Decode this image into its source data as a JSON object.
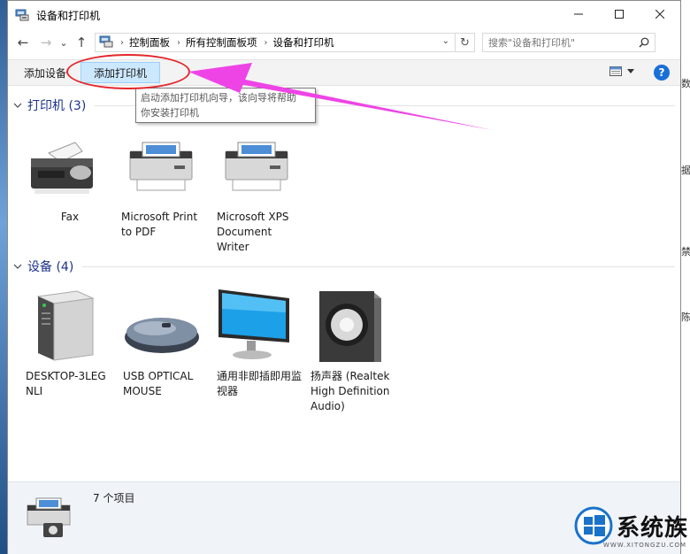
{
  "window": {
    "title": "设备和打印机"
  },
  "nav": {
    "breadcrumbs": [
      "控制面板",
      "所有控制面板项",
      "设备和打印机"
    ],
    "search_placeholder": "搜索\"设备和打印机\""
  },
  "toolbar": {
    "add_device": "添加设备",
    "add_printer": "添加打印机",
    "help": "?"
  },
  "tooltip": {
    "line1": "启动添加打印机向导，该向导将帮助",
    "line2": "你安装打印机"
  },
  "groups": {
    "printers": {
      "label": "打印机 (3)"
    },
    "devices": {
      "label": "设备 (4)"
    }
  },
  "printers": [
    {
      "name": "Fax",
      "icon": "fax-icon"
    },
    {
      "name": "Microsoft Print to PDF",
      "icon": "printer-icon"
    },
    {
      "name": "Microsoft XPS Document Writer",
      "icon": "printer-icon"
    }
  ],
  "devices": [
    {
      "name": "DESKTOP-3LEGNLI",
      "icon": "computer-tower-icon"
    },
    {
      "name": "USB OPTICAL MOUSE",
      "icon": "mouse-icon"
    },
    {
      "name": "通用非即插即用监视器",
      "icon": "monitor-icon"
    },
    {
      "name": "扬声器 (Realtek High Definition Audio)",
      "icon": "speaker-icon"
    }
  ],
  "details": {
    "count": "7 个项目"
  },
  "watermark": {
    "text": "系统族",
    "url": "WWW.XITONGZU.COM"
  },
  "desktop_glyphs": [
    "数",
    "据",
    "禁",
    "陈"
  ],
  "colors": {
    "accent": "#1a6fd6",
    "header": "#1e3287",
    "annotation": "#e3262d",
    "arrow": "#ee44e6"
  }
}
